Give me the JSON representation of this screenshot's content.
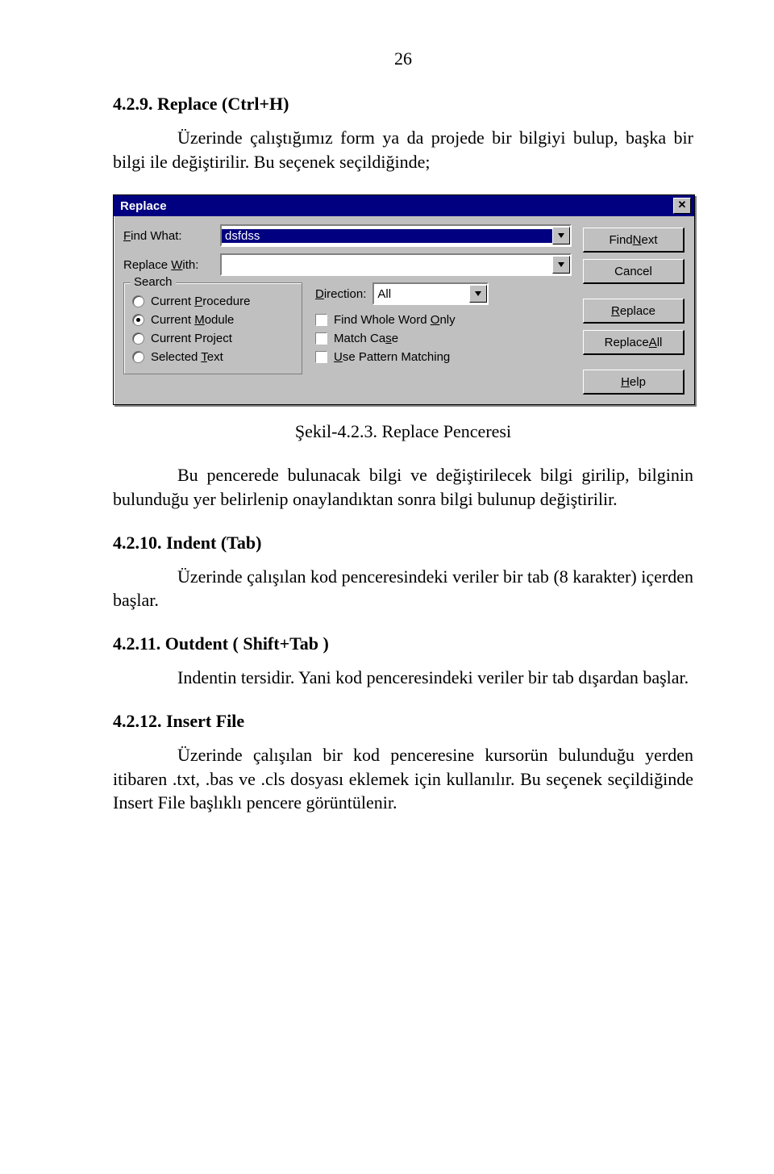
{
  "page_number": "26",
  "sections": {
    "s1": {
      "heading": "4.2.9. Replace (Ctrl+H)",
      "text": "Üzerinde çalıştığımız form ya da projede bir bilgiyi bulup, başka bir bilgi ile değiştirilir. Bu seçenek seçildiğinde;"
    },
    "caption": "Şekil-4.2.3. Replace Penceresi",
    "s2": {
      "text": "Bu pencerede bulunacak bilgi ve değiştirilecek bilgi girilip, bilginin bulunduğu yer belirlenip onaylandıktan sonra bilgi bulunup değiştirilir."
    },
    "s3": {
      "heading": "4.2.10. Indent (Tab)",
      "text": "Üzerinde çalışılan kod penceresindeki veriler bir tab (8 karakter) içerden başlar."
    },
    "s4": {
      "heading": "4.2.11. Outdent ( Shift+Tab )",
      "text": "Indentin tersidir. Yani kod penceresindeki veriler bir tab dışardan başlar."
    },
    "s5": {
      "heading": "4.2.12. Insert File",
      "text": "Üzerinde çalışılan bir kod penceresine kursorün bulunduğu yerden itibaren .txt, .bas ve .cls dosyası eklemek için kullanılır.  Bu seçenek seçildiğinde Insert File başlıklı pencere görüntülenir."
    }
  },
  "dialog": {
    "title": "Replace",
    "labels": {
      "find_what": "Find What:",
      "replace_with": "Replace With:",
      "direction": "Direction:"
    },
    "values": {
      "find_what": "dsfdss",
      "replace_with": "",
      "direction": "All"
    },
    "search_group": {
      "legend": "Search",
      "items": [
        {
          "label": "Current Procedure",
          "accel": "P",
          "checked": false
        },
        {
          "label": "Current Module",
          "accel": "M",
          "checked": true
        },
        {
          "label": "Current Project",
          "accel": "",
          "checked": false
        },
        {
          "label": "Selected Text",
          "accel": "T",
          "checked": false
        }
      ]
    },
    "options": [
      {
        "label": "Find Whole Word Only",
        "accel": "O"
      },
      {
        "label": "Match Case",
        "accel": "s"
      },
      {
        "label": "Use Pattern Matching",
        "accel": "U"
      }
    ],
    "buttons": {
      "find_next": "Find Next",
      "cancel": "Cancel",
      "replace": "Replace",
      "replace_all": "Replace All",
      "help": "Help"
    }
  }
}
